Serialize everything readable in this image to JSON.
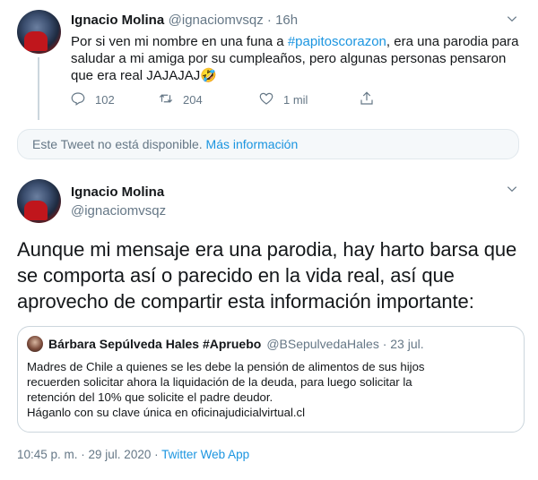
{
  "tweet1": {
    "name": "Ignacio Molina",
    "handle_time": "@ignaciomvsqz · 16h",
    "text_before": "Por si ven mi nombre en una funa a ",
    "hashtag": "#papitoscorazon",
    "text_after": ", era una parodia para saludar a mi amiga por su cumpleaños, pero algunas personas pensaron que era real JAJAJAJ🤣",
    "replies": "102",
    "retweets": "204",
    "likes": "1 mil"
  },
  "unavailable": {
    "text": "Este Tweet no está disponible. ",
    "link": "Más información"
  },
  "tweet2": {
    "name": "Ignacio Molina",
    "handle": "@ignaciomvsqz",
    "text": "Aunque mi mensaje era una parodia, hay harto barsa que se comporta así o parecido en la vida real, así que aprovecho de compartir esta información importante:",
    "timestamp": "10:45 p. m. · 29 jul. 2020 · ",
    "source": "Twitter Web App"
  },
  "quote": {
    "name": "Bárbara Sepúlveda Hales #Apruebo",
    "handle_time": "@BSepulvedaHales · 23 jul.",
    "line1": "Madres de Chile a quienes se les debe la pensión de alimentos de sus hijos",
    "line2": "recuerden solicitar ahora la liquidación de la deuda, para luego solicitar la",
    "line3": "retención del 10% que solicite el padre deudor.",
    "line4": "Háganlo con su clave única en oficinajudicialvirtual.cl"
  },
  "icons": {
    "reply": "reply-icon",
    "retweet": "retweet-icon",
    "like": "heart-icon",
    "share": "share-icon",
    "more": "chevron-down-icon"
  },
  "colors": {
    "link": "#1b95e0",
    "secondary": "#657786",
    "primary": "#14171a"
  }
}
